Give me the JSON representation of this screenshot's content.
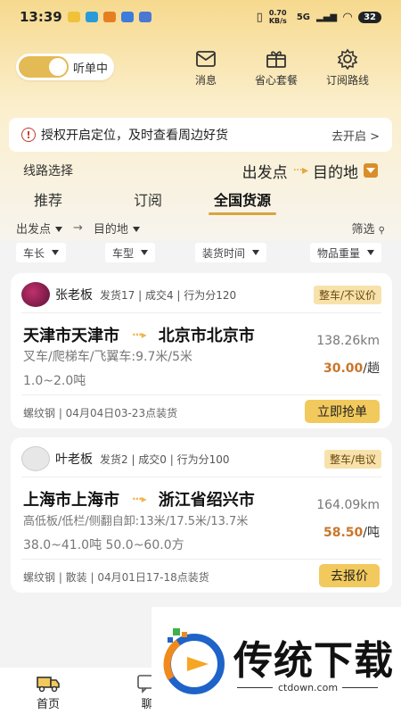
{
  "status_bar": {
    "time": "13:39",
    "network": "0.70 KB/s",
    "signal": "5G",
    "battery": "32"
  },
  "header": {
    "toggle_label": "听单中",
    "messages_label": "消息",
    "package_label": "省心套餐",
    "subscribe_label": "订阅路线"
  },
  "notice": {
    "text": "授权开启定位，及时查看周边好货",
    "action": "去开启 >"
  },
  "route_select": {
    "title": "线路选择",
    "origin": "出发点",
    "destination": "目的地"
  },
  "tabs": [
    {
      "label": "推荐"
    },
    {
      "label": "订阅"
    },
    {
      "label": "全国货源"
    }
  ],
  "filters": {
    "origin": "出发点",
    "destination": "目的地",
    "screen": "筛选",
    "chips": [
      "车长",
      "车型",
      "装货时间",
      "物品重量"
    ]
  },
  "listings": [
    {
      "owner": "张老板",
      "stats": "发货17 | 成交4 | 行为分120",
      "tag": "整车/不议价",
      "from": "天津市天津市",
      "to": "北京市北京市",
      "distance": "138.26km",
      "price_num": "30.00",
      "price_unit": "/趟",
      "spec1": "叉车/爬梯车/飞翼车:9.7米/5米",
      "spec2": "1.0~2.0吨",
      "footer": "螺纹钢 | 04月04日03-23点装货",
      "button": "立即抢单"
    },
    {
      "owner": "叶老板",
      "stats": "发货2 | 成交0 | 行为分100",
      "tag": "整车/电议",
      "from": "上海市上海市",
      "to": "浙江省绍兴市",
      "distance": "164.09km",
      "price_num": "58.50",
      "price_unit": "/吨",
      "spec1": "高低板/低栏/侧翻自卸:13米/17.5米/13.7米",
      "spec2": "38.0~41.0吨 50.0~60.0方",
      "footer": "螺纹钢 | 散装 | 04月01日17-18点装货",
      "button": "去报价"
    }
  ],
  "bottom_nav": {
    "home": "首页",
    "chat": "聊"
  },
  "watermark": {
    "title": "传统下载",
    "url": "ctdown.com"
  },
  "colors": {
    "accent": "#f2c95c",
    "price": "#c9762a",
    "header_gradient": "#f6d98e"
  }
}
